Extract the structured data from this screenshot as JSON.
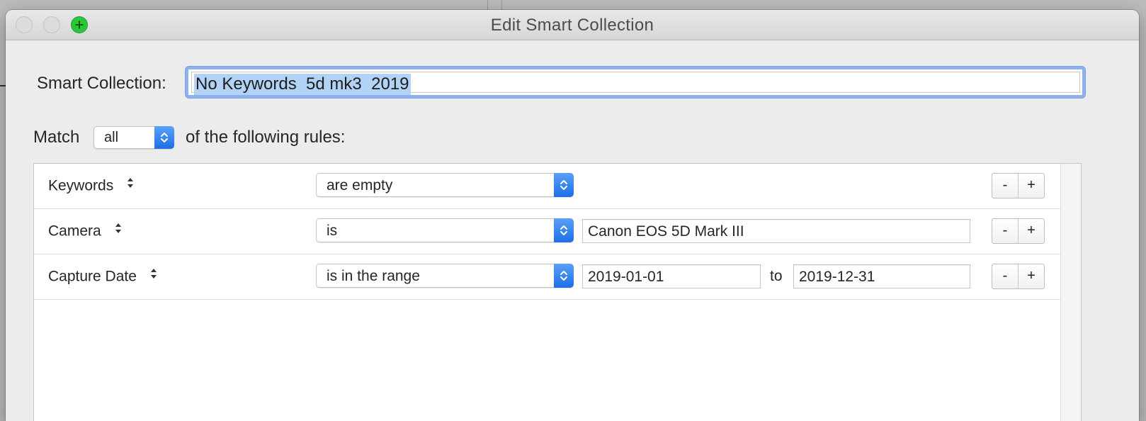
{
  "window": {
    "title": "Edit Smart Collection"
  },
  "name": {
    "label": "Smart Collection:",
    "value": "No Keywords  5d mk3  2019"
  },
  "match": {
    "prefix": "Match",
    "selected": "all",
    "suffix": "of the following rules:"
  },
  "rules": [
    {
      "field": "Keywords",
      "operator": "are empty",
      "remove": "-",
      "add": "+"
    },
    {
      "field": "Camera",
      "operator": "is",
      "value": "Canon EOS 5D Mark III",
      "remove": "-",
      "add": "+"
    },
    {
      "field": "Capture Date",
      "operator": "is in the range",
      "from": "2019-01-01",
      "range_sep": "to",
      "to": "2019-12-31",
      "remove": "-",
      "add": "+"
    }
  ],
  "colors": {
    "accent": "#1e6fe6",
    "selection": "#b3d3f6",
    "focus_ring": "#8fb2ef",
    "zoom_button": "#2fc53b"
  }
}
